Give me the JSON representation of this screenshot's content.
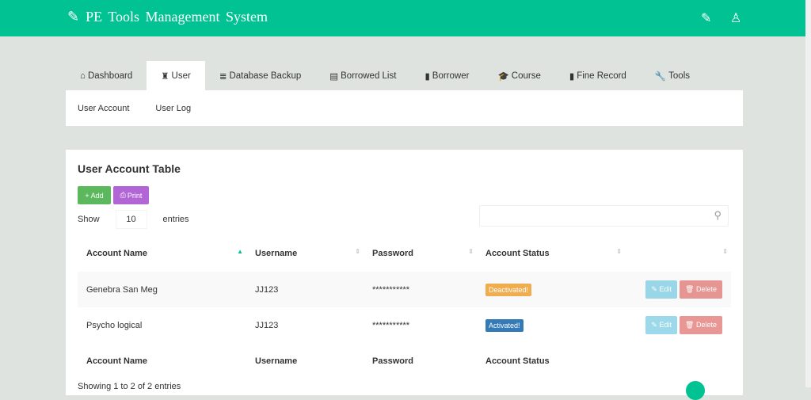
{
  "header": {
    "title": "PE Tools Management System"
  },
  "tabs": [
    {
      "label": "Dashboard",
      "icon": "home-icon",
      "glyph": "⌂"
    },
    {
      "label": "User",
      "icon": "user-lock-icon",
      "glyph": "♜"
    },
    {
      "label": "Database Backup",
      "icon": "database-icon",
      "glyph": "≣"
    },
    {
      "label": "Borrowed List",
      "icon": "list-icon",
      "glyph": "▤"
    },
    {
      "label": "Borrower",
      "icon": "book-icon",
      "glyph": "▮"
    },
    {
      "label": "Course",
      "icon": "graduation-cap-icon",
      "glyph": "🎓"
    },
    {
      "label": "Fine Record",
      "icon": "book-icon",
      "glyph": "▮"
    },
    {
      "label": "Tools",
      "icon": "wrench-icon",
      "glyph": "🔧"
    }
  ],
  "subnav": [
    "User Account",
    "User Log"
  ],
  "card": {
    "title": "User Account Table",
    "add": "Add",
    "print": "Print",
    "show": "Show",
    "entries_value": "10",
    "entries": "entries",
    "columns": [
      "Account Name",
      "Username",
      "Password",
      "Account Status"
    ],
    "rows": [
      {
        "name": "Genebra San Meg",
        "username": "JJ123",
        "password": "***********",
        "status": "Deactivated!",
        "status_color": "#f0ad4e"
      },
      {
        "name": "Psycho logical",
        "username": "JJ123",
        "password": "***********",
        "status": "Activated!",
        "status_color": "#337ab7"
      }
    ],
    "edit": "Edit",
    "delete": "Delete",
    "footer": "Showing 1 to 2 of 2 entries"
  }
}
